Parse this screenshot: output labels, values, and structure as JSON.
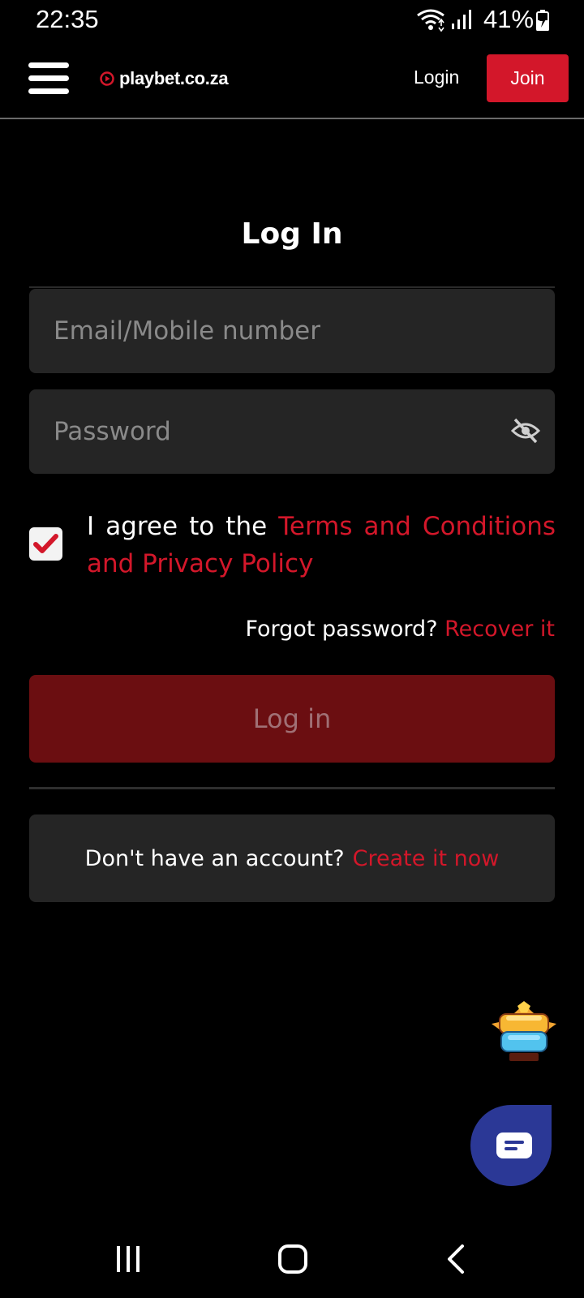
{
  "status_bar": {
    "time": "22:35",
    "battery": "41%",
    "icons": [
      "wifi-icon",
      "signal-icon",
      "battery-charging-icon"
    ]
  },
  "header": {
    "logo_text": "playbet.co.za",
    "login_label": "Login",
    "join_label": "Join"
  },
  "form": {
    "title": "Log In",
    "email_placeholder": "Email/Mobile number",
    "email_value": "",
    "password_placeholder": "Password",
    "password_value": "",
    "agree_prefix": "I agree to the ",
    "agree_link": "Terms and Conditions and Privacy Policy",
    "agree_checked": true,
    "forgot_text": "Forgot password? ",
    "forgot_link": "Recover it",
    "submit_label": "Log in",
    "no_account_text": "Don't have an account?",
    "create_link": "Create it now"
  },
  "badge": {
    "icon": "sky-pilot-logo"
  },
  "chat": {
    "icon": "chat-icon"
  },
  "colors": {
    "accent": "#d3172a",
    "field_bg": "#252525",
    "submit_disabled_bg": "#6b0e11",
    "chat_bg": "#2b3896"
  }
}
